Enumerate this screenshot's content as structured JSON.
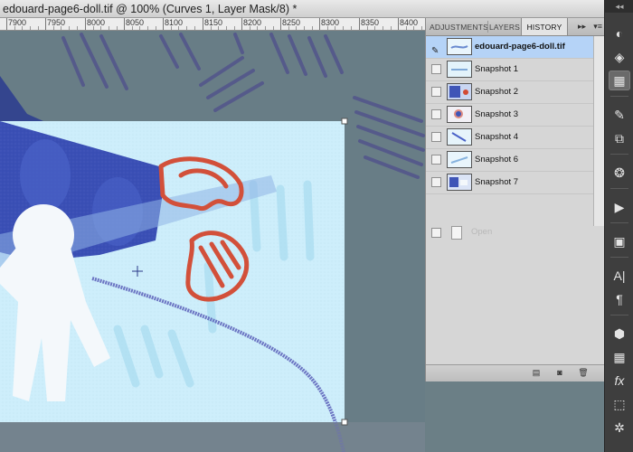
{
  "document": {
    "title": "edouard-page6-doll.tif @ 100% (Curves 1, Layer Mask/8) *"
  },
  "ruler": {
    "labels": [
      "7900",
      "7950",
      "8000",
      "8050",
      "8100",
      "8150",
      "8200",
      "8250",
      "8300",
      "8350",
      "8400"
    ]
  },
  "panel": {
    "tabs": [
      {
        "label": "ADJUSTMENTS",
        "active": false
      },
      {
        "label": "LAYERS",
        "active": false
      },
      {
        "label": "HISTORY",
        "active": true
      }
    ],
    "collapse_icon": "double-arrow-right-icon",
    "menu_icon": "panel-menu-icon",
    "history": [
      {
        "label": "edouard-page6-doll.tif",
        "selected": true
      },
      {
        "label": "Snapshot 1",
        "selected": false
      },
      {
        "label": "Snapshot 2",
        "selected": false
      },
      {
        "label": "Snapshot 3",
        "selected": false
      },
      {
        "label": "Snapshot 4",
        "selected": false
      },
      {
        "label": "Snapshot 6",
        "selected": false
      },
      {
        "label": "Snapshot 7",
        "selected": false
      }
    ],
    "state_row": {
      "label": "Open"
    },
    "footer_icons": [
      "new-document-from-state-icon",
      "camera-icon",
      "trash-icon"
    ]
  },
  "dock": {
    "tools": [
      "adjustments-icon",
      "layers-icon",
      "history-icon",
      "brush-icon",
      "clone-source-icon",
      "color-icon",
      "actions-icon",
      "navigator-icon",
      "character-icon",
      "paragraph-icon",
      "styles-icon",
      "swatches-icon",
      "fx-icon",
      "masks-icon",
      "transform-icon"
    ],
    "active_tool": "history-icon"
  },
  "colors": {
    "canvas_bg": "#6b7f86",
    "selected_row": "#b5d3f7",
    "dock_bg": "#3e3e3e",
    "doll_blue": "#3f55b7",
    "doll_red": "#d24a35",
    "pale_sky": "#c9ebf7"
  }
}
